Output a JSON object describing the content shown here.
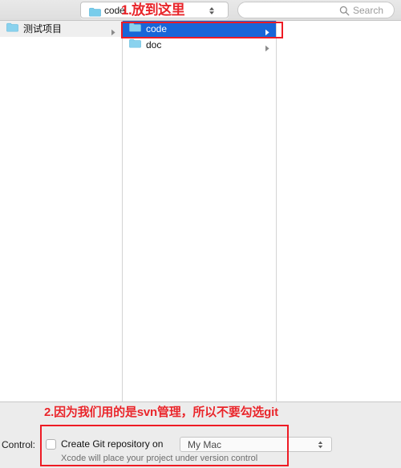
{
  "toolbar": {
    "path_popup": {
      "icon": "folder-icon",
      "value": "code"
    },
    "stepper_icon": "stepper-up-down-icon",
    "search": {
      "icon": "search-icon",
      "placeholder": "Search"
    }
  },
  "browser": {
    "columns": [
      {
        "name": "column-1",
        "rows": [
          {
            "label": "测试项目",
            "icon": "folder-icon",
            "selected": false,
            "shaded": true,
            "has_chevron": true
          }
        ]
      },
      {
        "name": "column-2",
        "rows": [
          {
            "label": "code",
            "icon": "folder-icon",
            "selected": true,
            "shaded": false,
            "has_chevron": true
          },
          {
            "label": "doc",
            "icon": "folder-icon",
            "selected": false,
            "shaded": false,
            "has_chevron": true
          }
        ]
      },
      {
        "name": "column-3",
        "rows": []
      }
    ]
  },
  "annotations": {
    "step1_text": "1.放到这里",
    "step2_text": "2.因为我们用的是svn管理，所以不要勾选git",
    "box_color": "#ee1b24",
    "text_color": "#e8252a"
  },
  "footer": {
    "control_label": "Control:",
    "git_checkbox": {
      "label": "Create Git repository on",
      "checked": false
    },
    "git_location": {
      "value": "My Mac",
      "stepper_icon": "stepper-up-down-icon"
    },
    "help_text": "Xcode will place your project under version control"
  },
  "colors": {
    "selection_blue": "#1866d8",
    "folder_blue": "#7ed0f0",
    "toolbar_gray": "#e4e4e4",
    "footer_gray": "#ececec"
  }
}
